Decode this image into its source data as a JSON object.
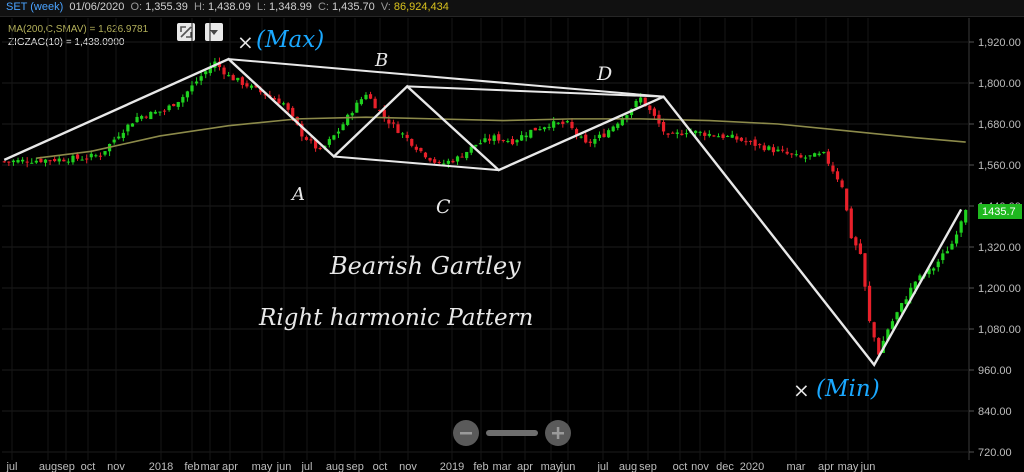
{
  "header": {
    "symbol": "SET (week)",
    "date": "01/06/2020",
    "open_label": "O:",
    "open": "1,355.39",
    "high_label": "H:",
    "high": "1,438.09",
    "low_label": "L:",
    "low": "1,348.99",
    "close_label": "C:",
    "close": "1,435.70",
    "volume_label": "V:",
    "volume": "86,924,434"
  },
  "legend": {
    "ma": "MA(200,C,SMAV) = 1,626.9781",
    "zigzag": "ZIGZAG(10) = 1,438.0900"
  },
  "toolbar": {
    "expand_icon": "expand-icon",
    "dropdown_icon": "chevron-down-icon"
  },
  "price_tag": "1435.7",
  "annotations": {
    "max": "(Max)",
    "min": "(Min)",
    "x_mark": "×",
    "a": "A",
    "b": "B",
    "c": "C",
    "d": "D",
    "title_line1": "Bearish Gartley",
    "title_line2": "Right harmonic Pattern"
  },
  "zoom": {
    "out_icon": "minus-icon",
    "in_icon": "plus-icon"
  },
  "colors": {
    "up": "#1fd11f",
    "down": "#e8202a",
    "ma": "#8c8a4a",
    "zigzag": "#e8e8e8",
    "note_blue": "#1aa8ff",
    "price_tag": "#1fb81f"
  },
  "chart_data": {
    "type": "candlestick",
    "yticks": [
      720,
      840,
      960,
      1080,
      1200,
      1320,
      1440,
      1560,
      1680,
      1800,
      1920
    ],
    "ylim": [
      700,
      1990
    ],
    "xticks": [
      "jul",
      "aug",
      "sep",
      "oct",
      "nov",
      "2018",
      "feb",
      "mar",
      "apr",
      "may",
      "jun",
      "jul",
      "aug",
      "sep",
      "oct",
      "nov",
      "2019",
      "feb",
      "mar",
      "apr",
      "may",
      "jun",
      "jul",
      "aug",
      "sep",
      "oct",
      "nov",
      "dec",
      "2020",
      "mar",
      "apr",
      "may",
      "jun"
    ],
    "close_path": [
      [
        1,
        1570
      ],
      [
        10,
        1575
      ],
      [
        18,
        1580
      ],
      [
        22,
        1590
      ],
      [
        26,
        1650
      ],
      [
        30,
        1700
      ],
      [
        36,
        1720
      ],
      [
        40,
        1760
      ],
      [
        44,
        1820
      ],
      [
        47,
        1860
      ],
      [
        50,
        1820
      ],
      [
        53,
        1800
      ],
      [
        56,
        1780
      ],
      [
        59,
        1760
      ],
      [
        62,
        1740
      ],
      [
        66,
        1650
      ],
      [
        70,
        1600
      ],
      [
        74,
        1660
      ],
      [
        77,
        1720
      ],
      [
        80,
        1770
      ],
      [
        84,
        1700
      ],
      [
        88,
        1650
      ],
      [
        92,
        1600
      ],
      [
        96,
        1560
      ],
      [
        100,
        1580
      ],
      [
        104,
        1620
      ],
      [
        108,
        1640
      ],
      [
        112,
        1630
      ],
      [
        116,
        1660
      ],
      [
        120,
        1680
      ],
      [
        124,
        1680
      ],
      [
        128,
        1620
      ],
      [
        132,
        1650
      ],
      [
        136,
        1700
      ],
      [
        140,
        1755
      ],
      [
        143,
        1700
      ],
      [
        146,
        1640
      ],
      [
        150,
        1660
      ],
      [
        155,
        1650
      ],
      [
        160,
        1640
      ],
      [
        165,
        1620
      ],
      [
        170,
        1600
      ],
      [
        175,
        1580
      ],
      [
        180,
        1590
      ],
      [
        184,
        1500
      ],
      [
        186,
        1350
      ],
      [
        188,
        1300
      ],
      [
        190,
        1100
      ],
      [
        192,
        1010
      ],
      [
        194,
        1080
      ],
      [
        197,
        1150
      ],
      [
        200,
        1220
      ],
      [
        204,
        1260
      ],
      [
        208,
        1330
      ],
      [
        211,
        1436
      ]
    ],
    "ma_path": [
      [
        8,
        1580
      ],
      [
        20,
        1600
      ],
      [
        35,
        1645
      ],
      [
        50,
        1675
      ],
      [
        65,
        1695
      ],
      [
        80,
        1700
      ],
      [
        95,
        1695
      ],
      [
        110,
        1690
      ],
      [
        125,
        1695
      ],
      [
        140,
        1695
      ],
      [
        155,
        1690
      ],
      [
        170,
        1680
      ],
      [
        185,
        1660
      ],
      [
        200,
        1640
      ],
      [
        211,
        1627
      ]
    ],
    "zigzag": [
      [
        1,
        1575
      ],
      [
        50,
        1870
      ],
      [
        73,
        1585
      ],
      [
        89,
        1790
      ],
      [
        109,
        1545
      ],
      [
        145,
        1760
      ],
      [
        191,
        975
      ],
      [
        210,
        1430
      ]
    ],
    "pattern_lines": [
      [
        [
          50,
          1870
        ],
        [
          145,
          1760
        ]
      ],
      [
        [
          73,
          1585
        ],
        [
          109,
          1545
        ]
      ],
      [
        [
          89,
          1790
        ],
        [
          145,
          1760
        ]
      ]
    ]
  }
}
